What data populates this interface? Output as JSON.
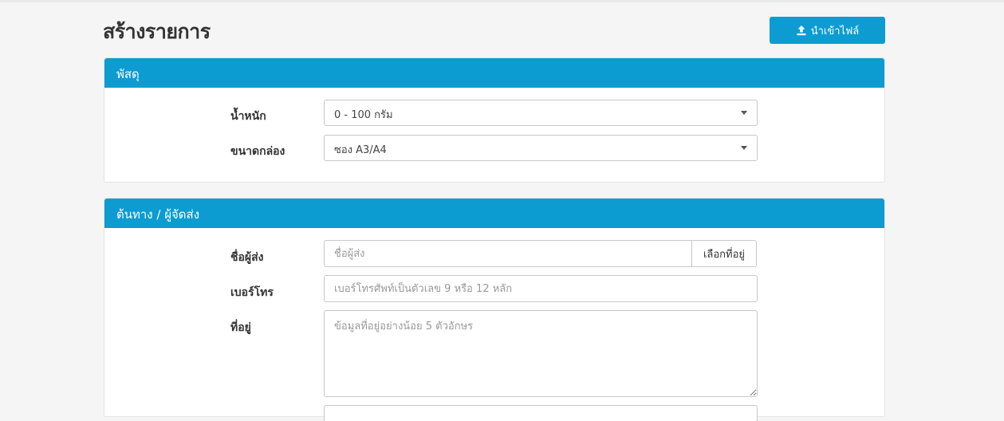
{
  "page": {
    "title": "สร้างรายการ",
    "import_button": "นำเข้าไฟล์"
  },
  "colors": {
    "accent": "#0c9cd1",
    "background": "#f5f5f5"
  },
  "parcel_section": {
    "header": "พัสดุ",
    "weight": {
      "label": "น้ำหนัก",
      "selected": "0 - 100 กรัม"
    },
    "box_size": {
      "label": "ขนาดกล่อง",
      "selected": "ซอง A3/A4"
    }
  },
  "origin_section": {
    "header": "ต้นทาง / ผู้จัดส่ง",
    "sender_name": {
      "label": "ชื่อผู้ส่ง",
      "placeholder": "ชื่อผู้ส่ง",
      "value": "",
      "addon_button": "เลือกที่อยู่"
    },
    "phone": {
      "label": "เบอร์โทร",
      "placeholder": "เบอร์โทรศัพท์เป็นตัวเลข 9 หรือ 12 หลัก",
      "value": ""
    },
    "address": {
      "label": "ที่อยู่",
      "placeholder": "ข้อมูลที่อยู่อย่างน้อย 5 ตัวอักษร",
      "value": ""
    }
  },
  "icons": {
    "import": "upload-icon",
    "dropdown": "chevron-down-icon"
  }
}
